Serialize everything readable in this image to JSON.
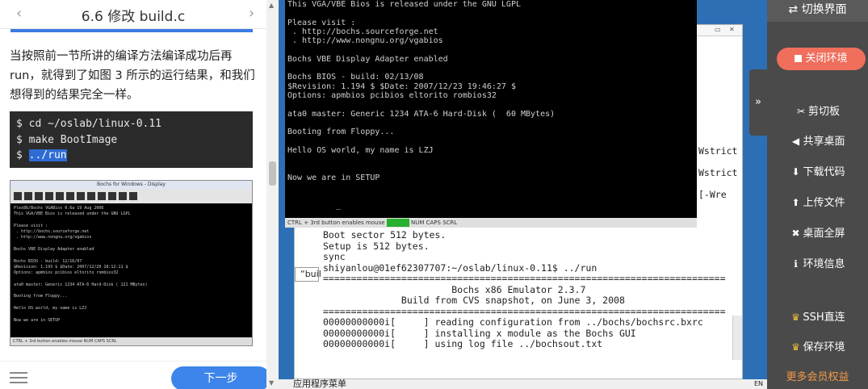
{
  "doc": {
    "prev": "‹",
    "next": "›",
    "title": "6.6 修改 build.c",
    "paragraph": "当按照前一节所讲的编译方法编译成功后再run，就得到了如图 3 所示的运行结果，和我们想得到的结果完全一样。",
    "code": {
      "line1": "$ cd ~/oslab/linux-0.11",
      "line2": "$ make BootImage",
      "line3_prefix": "$ ",
      "line3_sel": "../run"
    },
    "thumb": {
      "title": "Bochs for Windows - Display",
      "screen": "Plex86/Bochs VGABios 0.6a 19 Aug 2006\nThis VGA/VBE Bios is released under the GNU LGPL\n\nPlease visit :\n . http://bochs.sourceforge.net\n . http://www.nongnu.org/vgabios\n\nBochs VBE Display Adapter enabled\n\nBochs BIOS - build: 12/16/07\n$Revision: 1.193 $ $Date: 2007/12/20 18:12:11 $\nOptions: apmbios pcibios eltorito rombios32\n\nata0 master: Generic 1234 ATA-6 Hard-Disk ( 121 MBytes)\n\nBooting from Floppy...\n\nHello OS world, my name is LZJ\n\nNow we are in SETUP",
      "status": "CTRL + 3rd button enables mouse          NUM  CAPS  SCRL"
    },
    "next_button": "下一步"
  },
  "bochs": {
    "screen": "This VGA/VBE Bios is released under the GNU LGPL\n\nPlease visit :\n . http://bochs.sourceforge.net\n . http://www.nongnu.org/vgabios\n\nBochs VBE Display Adapter enabled\n\nBochs BIOS - build: 02/13/08\n$Revision: 1.194 $ $Date: 2007/12/23 19:46:27 $\nOptions: apmbios pcibios eltorito rombios32\n\nata0 master: Generic 1234 ATA-6 Hard-Disk (  60 MBytes)\n\nBooting from Floppy...\n\nHello OS world, my name is LZJ\n\n\nNow we are in SETUP\n\n\n          _",
    "status_left": "CTRL + 3rd button enables mouse",
    "status_right": "NUM  CAPS  SCRL"
  },
  "terminal": {
    "right_1": "Wstrict",
    "right_2": "Wstrict",
    "right_3": "[-Wre",
    "body": "Boot sector 512 bytes.\nSetup is 512 bytes.\nsync\nshiyanlou@01ef62307707:~/oslab/linux-0.11$ ../run\n========================================================================\n                       Bochs x86 Emulator 2.3.7\n              Build from CVS snapshot, on June 3, 2008\n========================================================================\n00000000000i[     ] reading configuration from ../bochs/bochsrc.bxrc\n00000000000i[     ] installing x module as the Bochs GUI\n00000000000i[     ] using log file ../bochsout.txt",
    "quote": "“buil"
  },
  "taskbar": {
    "label": "应用程序菜单",
    "right": "EN"
  },
  "toolbar": {
    "switch": "⇄ 切换界面",
    "close": "关闭环境",
    "tab": "»",
    "items": [
      {
        "icon": "✂",
        "label": "剪切板"
      },
      {
        "icon": "◀",
        "label": "共享桌面"
      },
      {
        "icon": "⬇",
        "label": "下载代码"
      },
      {
        "icon": "⬆",
        "label": "上传文件"
      },
      {
        "icon": "✖",
        "label": "桌面全屏"
      },
      {
        "icon": "ℹ",
        "label": "环境信息"
      },
      {
        "icon": "♛",
        "label": "SSH直连"
      },
      {
        "icon": "♛",
        "label": "保存环境"
      }
    ],
    "vip": "更多会员权益"
  }
}
